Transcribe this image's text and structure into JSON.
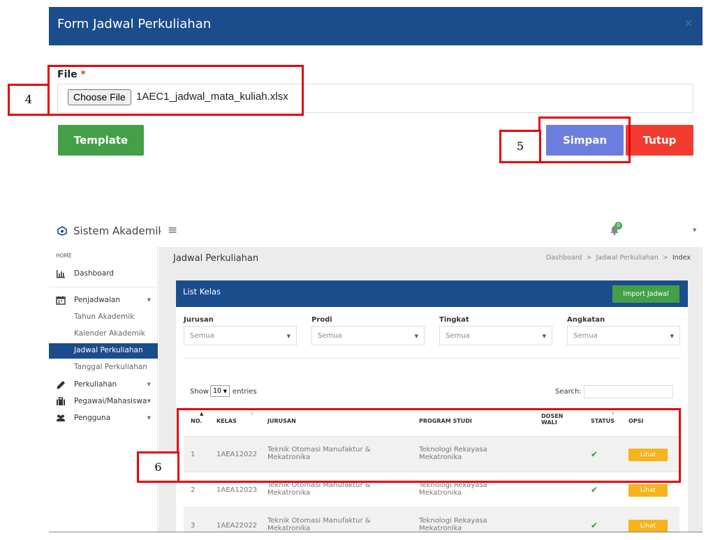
{
  "modal": {
    "title": "Form Jadwal Perkuliahan",
    "close_icon": "×",
    "file_label": "File",
    "required_mark": "*",
    "choose_button": "Choose File",
    "file_name": "1AEC1_jadwal_mata_kuliah.xlsx",
    "template_button": "Template",
    "save_button": "Simpan",
    "close_button": "Tutup"
  },
  "annotations": {
    "a4": "4",
    "a5": "5",
    "a6": "6"
  },
  "app": {
    "brand": "Sistem Akademik",
    "notification_count": "0",
    "sidebar": {
      "home_label": "HOME",
      "dashboard": "Dashboard",
      "penjadwalan": "Penjadwalan",
      "tahun_akademik": "Tahun Akademik",
      "kalender_akademik": "Kalender Akademik",
      "jadwal_perkuliahan": "Jadwal Perkuliahan",
      "tanggal_perkuliahan": "Tanggal Perkuliahan",
      "perkuliahan": "Perkuliahan",
      "pegawai_mahasiswa": "Pegawai/Mahasiswa",
      "pengguna": "Pengguna"
    },
    "page_title": "Jadwal Perkuliahan",
    "breadcrumb": [
      "Dashboard",
      "Jadwal Perkuliahan",
      "Index"
    ],
    "breadcrumb_sep": ">",
    "card_title": "List Kelas",
    "import_button": "Import Jadwal",
    "filters": [
      {
        "label": "Jurusan",
        "value": "Semua"
      },
      {
        "label": "Prodi",
        "value": "Semua"
      },
      {
        "label": "Tingkat",
        "value": "Semua"
      },
      {
        "label": "Angkatan",
        "value": "Semua"
      }
    ],
    "show_label": "Show",
    "show_value": "10",
    "entries_label": "entries",
    "search_label": "Search:",
    "columns": {
      "no": "NO.",
      "kelas": "KELAS",
      "jurusan": "JURUSAN",
      "program_studi": "PROGRAM STUDI",
      "dosen_wali_1": "DOSEN",
      "dosen_wali_2": "WALI",
      "status": "STATUS",
      "opsi": "OPSI"
    },
    "rows": [
      {
        "no": "1",
        "kelas": "1AEA12022",
        "jurusan_1": "Teknik Otomasi Manufaktur &",
        "jurusan_2": "Mekatronika",
        "prodi_1": "Teknologi Rekayasa",
        "prodi_2": "Mekatronika",
        "status": "✔",
        "action": "Lihat"
      },
      {
        "no": "2",
        "kelas": "1AEA12023",
        "jurusan_1": "Teknik Otomasi Manufaktur &",
        "jurusan_2": "Mekatronika",
        "prodi_1": "Teknologi Rekayasa",
        "prodi_2": "Mekatronika",
        "status": "✔",
        "action": "Lihat"
      },
      {
        "no": "3",
        "kelas": "1AEA22022",
        "jurusan_1": "Teknik Otomasi Manufaktur &",
        "jurusan_2": "Mekatronika",
        "prodi_1": "Teknologi Rekayasa",
        "prodi_2": "Mekatronika",
        "status": "✔",
        "action": "Lihat"
      }
    ]
  },
  "colors": {
    "primary": "#1b4c8c",
    "success": "#43a047",
    "save": "#6b7ee0",
    "danger": "#f23b2f",
    "warning": "#f5b31c",
    "annotation": "#e8000b"
  }
}
